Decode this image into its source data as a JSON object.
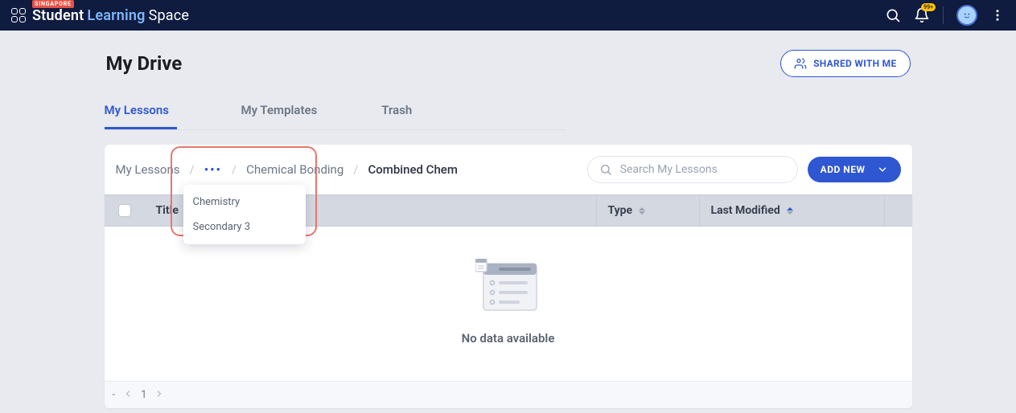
{
  "brand": {
    "tag": "SINGAPORE",
    "word1": "Student",
    "word2": "Learning",
    "word3": "Space",
    "notification_count": "99+"
  },
  "page": {
    "title": "My Drive",
    "shared_button": "SHARED WITH ME"
  },
  "tabs": [
    {
      "label": "My Lessons",
      "active": true
    },
    {
      "label": "My Templates",
      "active": false
    },
    {
      "label": "Trash",
      "active": false
    }
  ],
  "breadcrumb": {
    "root": "My Lessons",
    "ellipsis": "•••",
    "mid": "Chemical Bonding",
    "current": "Combined Chem",
    "dropdown": [
      "Chemistry",
      "Secondary 3"
    ]
  },
  "search": {
    "placeholder": "Search My Lessons"
  },
  "add_new_label": "ADD NEW",
  "columns": {
    "title": "Title",
    "type": "Type",
    "last_modified": "Last Modified"
  },
  "empty_message": "No data available",
  "pagination": {
    "dash": "-",
    "page": "1"
  }
}
